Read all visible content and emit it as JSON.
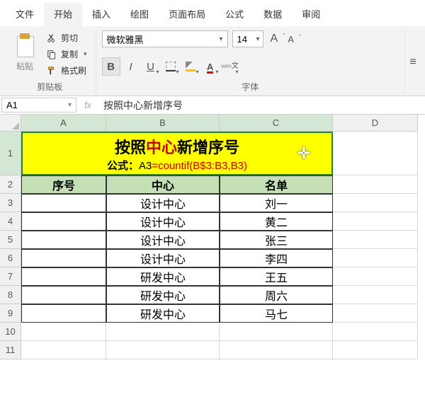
{
  "menu": {
    "tabs": [
      "文件",
      "开始",
      "插入",
      "绘图",
      "页面布局",
      "公式",
      "数据",
      "审阅"
    ],
    "active": 1
  },
  "clipboard": {
    "paste": "粘贴",
    "cut": "剪切",
    "copy": "复制",
    "format_painter": "格式刷",
    "group_label": "剪贴板"
  },
  "font": {
    "family": "微软雅黑",
    "size": "14",
    "grow": "A",
    "shrink": "A",
    "bold": "B",
    "italic": "I",
    "underline": "U",
    "fontcolor_letter": "A",
    "wen_pinyin": "wén",
    "wen_char": "文",
    "group_label": "字体"
  },
  "formula_bar": {
    "namebox": "A1",
    "fx": "fx",
    "value": "按照中心新增序号"
  },
  "sheet": {
    "cols": [
      "A",
      "B",
      "C",
      "D"
    ],
    "title_main_pre": "按照",
    "title_main_red": "中心",
    "title_main_post": "新增序号",
    "title_formula_label": "公式：",
    "title_formula_prefix": "A3",
    "title_formula_expr": "=countif(B$3:B3,B3)",
    "headers": [
      "序号",
      "中心",
      "名单"
    ],
    "rows": [
      {
        "a": "",
        "b": "设计中心",
        "c": "刘一"
      },
      {
        "a": "",
        "b": "设计中心",
        "c": "黄二"
      },
      {
        "a": "",
        "b": "设计中心",
        "c": "张三"
      },
      {
        "a": "",
        "b": "设计中心",
        "c": "李四"
      },
      {
        "a": "",
        "b": "研发中心",
        "c": "王五"
      },
      {
        "a": "",
        "b": "研发中心",
        "c": "周六"
      },
      {
        "a": "",
        "b": "研发中心",
        "c": "马七"
      }
    ]
  }
}
